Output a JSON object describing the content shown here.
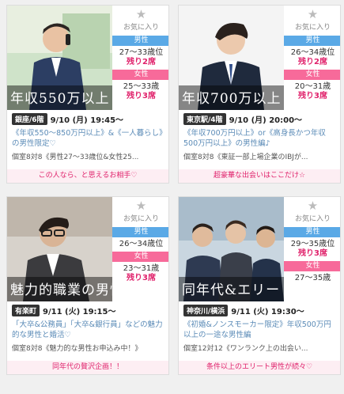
{
  "cards": [
    {
      "overlay": "年収550万以上",
      "favorite_label": "お気に入り",
      "male_label": "男性",
      "male_age": "27〜33歳位",
      "male_seats": "残り2席",
      "female_label": "女性",
      "female_age": "25〜33歳",
      "female_seats": "残り3席",
      "venue": "銀座/6階",
      "datetime": "9/10 (月) 19:45〜",
      "title": "《年収550〜850万円以上》&《一人暮らし》の男性限定♡",
      "detail": "個室8対8《男性27〜33歳位&女性25...",
      "tagline": "この人なら、と思えるお相手♡"
    },
    {
      "overlay": "年収700万以上",
      "favorite_label": "お気に入り",
      "male_label": "男性",
      "male_age": "26〜34歳位",
      "male_seats": "残り2席",
      "female_label": "女性",
      "female_age": "20〜31歳",
      "female_seats": "残り3席",
      "venue": "東京駅/4階",
      "datetime": "9/10 (月) 20:00〜",
      "title": "《年収700万円以上》or《高身長かつ年収500万円以上》の男性編♪",
      "detail": "個室8対8《東証一部上場企業のIBJが...",
      "tagline": "超豪華な出会いはここだけ☆"
    },
    {
      "overlay": "魅力的職業の男性",
      "favorite_label": "お気に入り",
      "male_label": "男性",
      "male_age": "26〜34歳位",
      "male_seats": "",
      "female_label": "女性",
      "female_age": "23〜31歳",
      "female_seats": "残り3席",
      "venue": "有楽町",
      "datetime": "9/11 (火) 19:15〜",
      "title": "「大卒&公務員」「大卒&銀行員」などの魅力的な男性と婚活♡",
      "detail": "個室8対8《魅力的な男性お申込み中！》",
      "tagline": "同年代の贅沢企画！！"
    },
    {
      "overlay": "同年代&エリート",
      "favorite_label": "お気に入り",
      "male_label": "男性",
      "male_age": "29〜35歳位",
      "male_seats": "残り3席",
      "female_label": "女性",
      "female_age": "27〜35歳",
      "female_seats": "",
      "venue": "神奈川/横浜",
      "datetime": "9/11 (火) 19:30〜",
      "title": "《初婚&ノンスモーカー限定》年収500万円以上の一途な男性編",
      "detail": "個室12対12《ワンランク上の出会い...",
      "tagline": "条件以上のエリート男性が続々♡"
    }
  ]
}
